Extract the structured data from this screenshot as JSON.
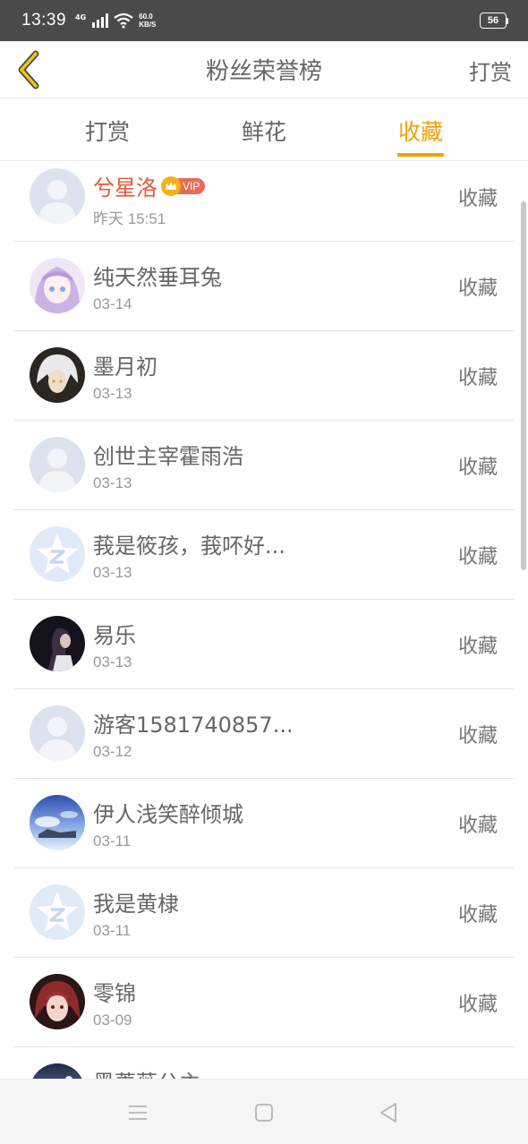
{
  "status_bar": {
    "time": "13:39",
    "network": "4G",
    "speed_value": "60.0",
    "speed_unit": "KB/S",
    "battery": "56"
  },
  "header": {
    "title": "粉丝荣誉榜",
    "action": "打赏"
  },
  "tabs": [
    {
      "label": "打赏",
      "active": false
    },
    {
      "label": "鲜花",
      "active": false
    },
    {
      "label": "收藏",
      "active": true
    }
  ],
  "colors": {
    "accent": "#f5a000",
    "vip_name": "#e45a3a",
    "vip_tag": "#ea6b54"
  },
  "list": [
    {
      "name": "兮星洛",
      "date": "昨天 15:51",
      "action": "收藏",
      "vip": true,
      "vip_label": "VIP",
      "avatar": "default-avatar-icon"
    },
    {
      "name": "纯天然垂耳兔",
      "date": "03-14",
      "action": "收藏",
      "avatar": "anime-girl-avatar"
    },
    {
      "name": "墨月初",
      "date": "03-13",
      "action": "收藏",
      "avatar": "white-hair-avatar"
    },
    {
      "name": "创世主宰霍雨浩",
      "date": "03-13",
      "action": "收藏",
      "avatar": "default-avatar-icon"
    },
    {
      "name": "莪是筱孩，莪吥好...",
      "date": "03-13",
      "action": "收藏",
      "avatar": "qzone-star-icon"
    },
    {
      "name": "易乐",
      "date": "03-13",
      "action": "收藏",
      "avatar": "dark-portrait-avatar"
    },
    {
      "name": "游客1581740857...",
      "date": "03-12",
      "action": "收藏",
      "avatar": "default-avatar-icon"
    },
    {
      "name": "伊人浅笑醉倾城",
      "date": "03-11",
      "action": "收藏",
      "avatar": "sky-scene-avatar"
    },
    {
      "name": "我是黄棣",
      "date": "03-11",
      "action": "收藏",
      "avatar": "qzone-star-icon"
    },
    {
      "name": "零锦",
      "date": "03-09",
      "action": "收藏",
      "avatar": "red-hair-avatar"
    },
    {
      "name": "黑蔷薇公主",
      "date": "",
      "action": "",
      "avatar": "dark-sky-avatar"
    }
  ]
}
